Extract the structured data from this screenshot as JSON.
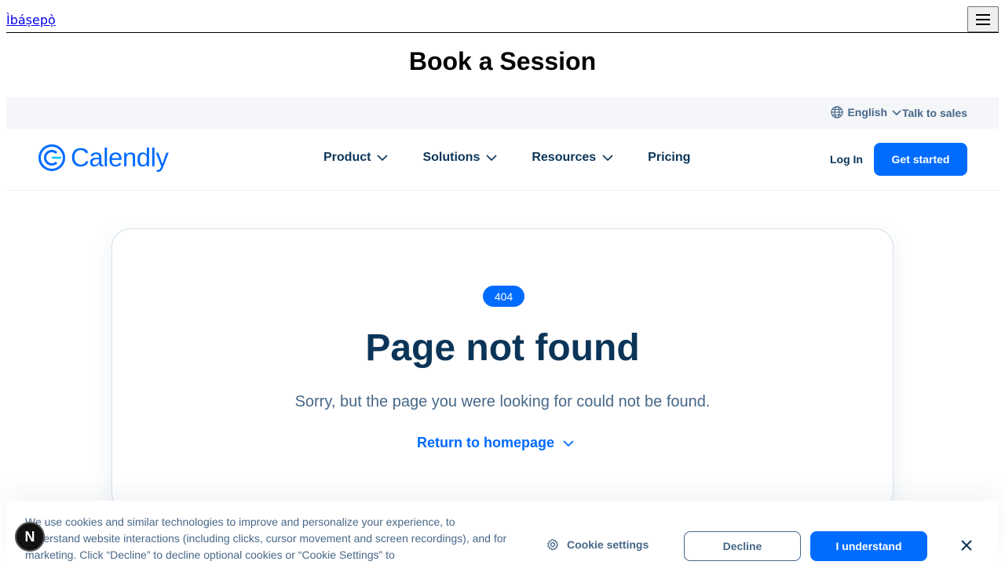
{
  "topbar": {
    "home_link": "Ìbáṣepọ̀",
    "menu_icon": "hamburger-icon"
  },
  "page_heading": "Book a Session",
  "utility": {
    "language": "English",
    "talk_to_sales": "Talk to sales",
    "globe_icon": "globe-icon"
  },
  "nav": {
    "logo_text": "Calendly",
    "items": [
      {
        "label": "Product",
        "has_dropdown": true
      },
      {
        "label": "Solutions",
        "has_dropdown": true
      },
      {
        "label": "Resources",
        "has_dropdown": true
      },
      {
        "label": "Pricing",
        "has_dropdown": false
      }
    ],
    "login": "Log In",
    "get_started": "Get started"
  },
  "error": {
    "badge": "404",
    "title": "Page not found",
    "subtitle": "Sorry, but the page you were looking for could not be found.",
    "return_link": "Return to homepage"
  },
  "cookie": {
    "text": "We use cookies and similar technologies to improve and personalize your experience, to understand website interactions (including clicks, cursor movement and screen recordings), and for marketing. Click “Decline” to decline optional cookies or “Cookie Settings” to",
    "settings_label": "Cookie settings",
    "decline_label": "Decline",
    "accept_label": "I understand"
  },
  "dev_badge": "N",
  "colors": {
    "brand": "#006bff",
    "text_dark": "#0b3558",
    "text_muted": "#476788",
    "utility_bg": "#f4f6f9"
  }
}
